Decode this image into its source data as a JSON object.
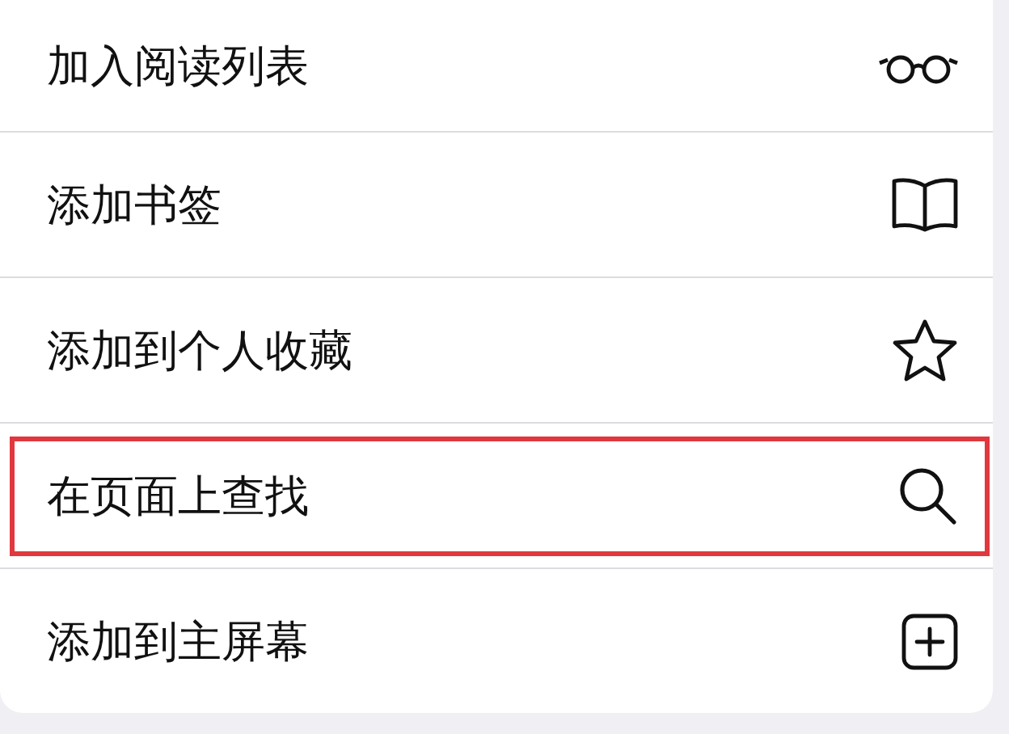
{
  "menu": {
    "items": [
      {
        "label": "加入阅读列表",
        "highlighted": false
      },
      {
        "label": "添加书签",
        "highlighted": false
      },
      {
        "label": "添加到个人收藏",
        "highlighted": false
      },
      {
        "label": "在页面上查找",
        "highlighted": true
      },
      {
        "label": "添加到主屏幕",
        "highlighted": false
      }
    ]
  }
}
